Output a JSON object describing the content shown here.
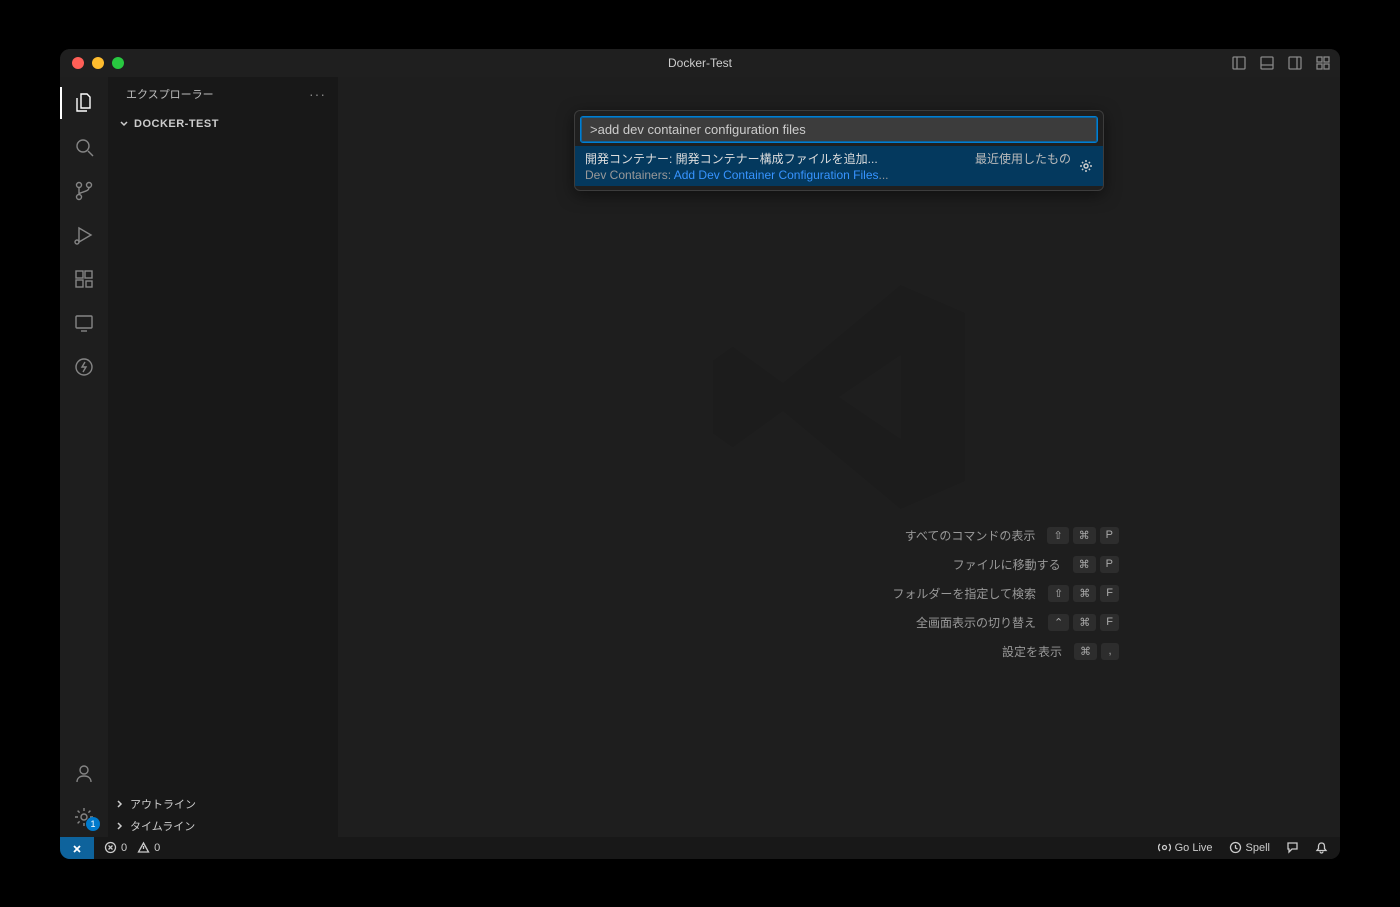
{
  "titlebar": {
    "title": "Docker-Test"
  },
  "sidebar": {
    "header": "エクスプローラー",
    "folder": "DOCKER-TEST",
    "outline": "アウトライン",
    "timeline": "タイムライン"
  },
  "activity": {
    "settings_badge": "1"
  },
  "command_palette": {
    "input_value": ">add dev container configuration files",
    "item": {
      "category_ja": "開発コンテナー: 開発コンテナー構成ファイルを追加...",
      "recent_label": "最近使用したもの",
      "prefix": "Dev Containers: ",
      "highlight": "Add Dev Container Configuration Files",
      "suffix": "..."
    }
  },
  "shortcuts": [
    {
      "label": "すべてのコマンドの表示",
      "keys": [
        "⇧",
        "⌘",
        "P"
      ]
    },
    {
      "label": "ファイルに移動する",
      "keys": [
        "⌘",
        "P"
      ]
    },
    {
      "label": "フォルダーを指定して検索",
      "keys": [
        "⇧",
        "⌘",
        "F"
      ]
    },
    {
      "label": "全画面表示の切り替え",
      "keys": [
        "⌃",
        "⌘",
        "F"
      ]
    },
    {
      "label": "設定を表示",
      "keys": [
        "⌘",
        ","
      ]
    }
  ],
  "statusbar": {
    "errors": "0",
    "warnings": "0",
    "go_live": "Go Live",
    "spell": "Spell"
  }
}
